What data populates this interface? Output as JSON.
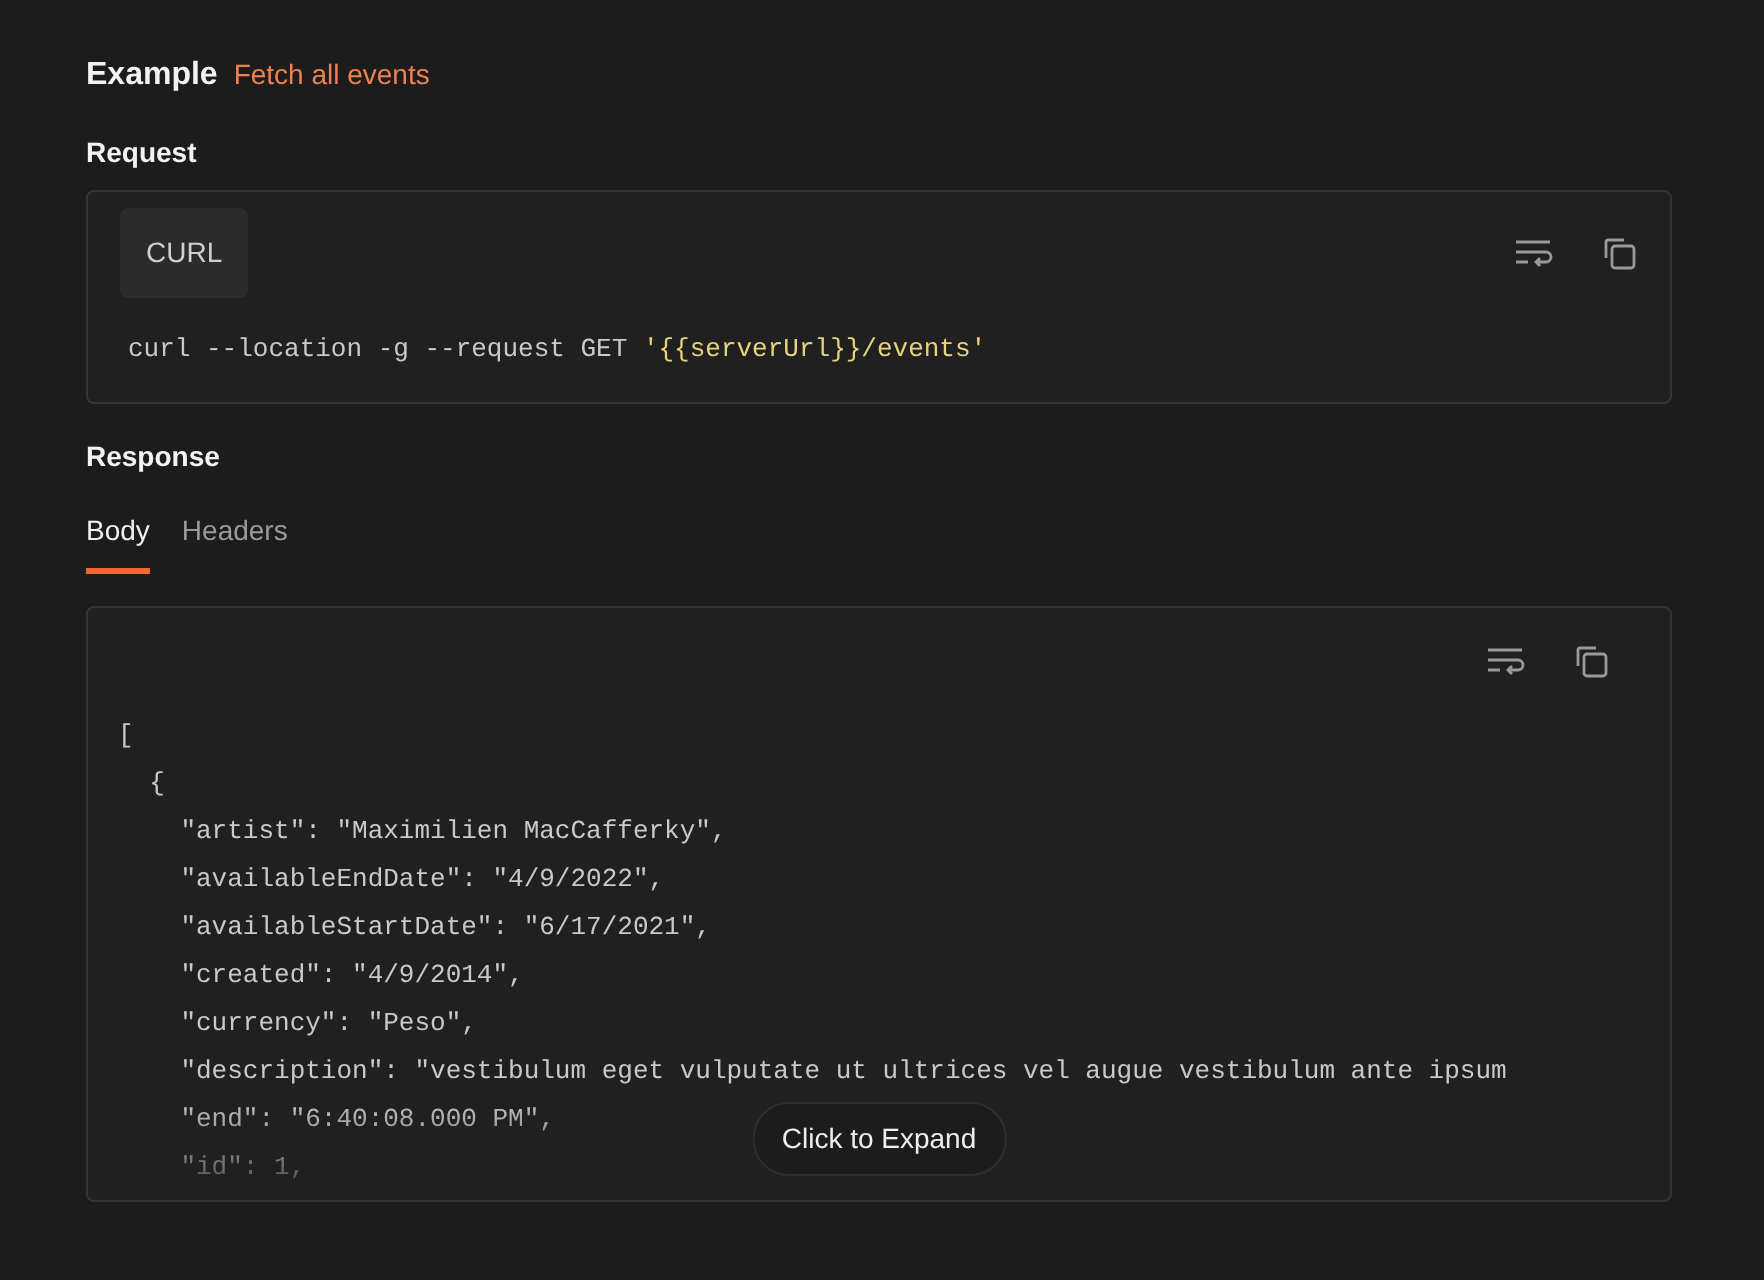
{
  "example": {
    "title": "Example",
    "link": "Fetch all events"
  },
  "request": {
    "heading": "Request",
    "language_tab": "CURL",
    "command": [
      {
        "kind": "plain",
        "text": "curl --location -g --request GET "
      },
      {
        "kind": "string",
        "text": "'{{serverUrl}}/events'"
      }
    ]
  },
  "response": {
    "heading": "Response",
    "tabs": [
      {
        "label": "Body",
        "selected": true
      },
      {
        "label": "Headers",
        "selected": false
      }
    ],
    "code_lines": [
      "[",
      "  {",
      "    \"artist\": \"Maximilien MacCafferky\",",
      "    \"availableEndDate\": \"4/9/2022\",",
      "    \"availableStartDate\": \"6/17/2021\",",
      "    \"created\": \"4/9/2014\",",
      "    \"currency\": \"Peso\",",
      "    \"description\": \"vestibulum eget vulputate ut ultrices vel augue vestibulum ante ipsum",
      "    \"end\": \"6:40:08.000 PM\",",
      "    \"id\": 1,"
    ],
    "expand_button": "Click to Expand"
  }
}
